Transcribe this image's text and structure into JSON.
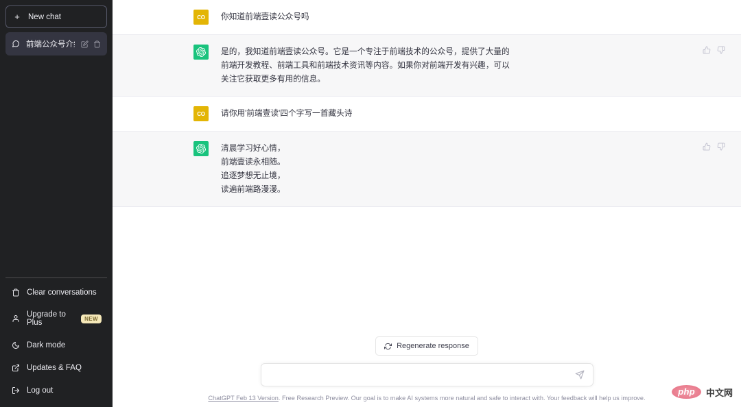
{
  "sidebar": {
    "new_chat_label": "New chat",
    "conversations": [
      {
        "title": "前端公众号介绍",
        "icon": "chat-bubble-icon",
        "edit_icon": "pencil-icon",
        "delete_icon": "trash-icon"
      }
    ],
    "bottom_items": [
      {
        "label": "Clear conversations",
        "icon": "trash-icon",
        "badge": ""
      },
      {
        "label": "Upgrade to Plus",
        "icon": "user-icon",
        "badge": "NEW"
      },
      {
        "label": "Dark mode",
        "icon": "moon-icon",
        "badge": ""
      },
      {
        "label": "Updates & FAQ",
        "icon": "external-link-icon",
        "badge": ""
      },
      {
        "label": "Log out",
        "icon": "logout-icon",
        "badge": ""
      }
    ]
  },
  "conversation": {
    "messages": [
      {
        "role": "user",
        "avatar_initials": "CO",
        "avatar_color": "#e3b505",
        "text": "你知道前端壹读公众号吗",
        "lines": []
      },
      {
        "role": "assistant",
        "avatar_initials": "",
        "avatar_color": "#19c37d",
        "text": "是的，我知道前端壹读公众号。它是一个专注于前端技术的公众号，提供了大量的前端开发教程、前端工具和前端技术资讯等内容。如果你对前端开发有兴趣，可以关注它获取更多有用的信息。",
        "lines": [],
        "feedback": {
          "up_icon": "thumbs-up-icon",
          "down_icon": "thumbs-down-icon"
        }
      },
      {
        "role": "user",
        "avatar_initials": "CO",
        "avatar_color": "#e3b505",
        "text": "请你用'前端壹读'四个字写一首藏头诗",
        "lines": []
      },
      {
        "role": "assistant",
        "avatar_initials": "",
        "avatar_color": "#19c37d",
        "text": "",
        "lines": [
          "清晨学习好心情，",
          "前端壹读永相随。",
          "追逐梦想无止境，",
          "读遍前端路漫漫。"
        ],
        "feedback": {
          "up_icon": "thumbs-up-icon",
          "down_icon": "thumbs-down-icon"
        }
      }
    ]
  },
  "composer": {
    "regenerate_label": "Regenerate response",
    "regenerate_icon": "refresh-icon",
    "input_value": "",
    "input_placeholder": "",
    "send_icon": "send-icon"
  },
  "footer": {
    "link_text": "ChatGPT Feb 13 Version",
    "rest_text": ". Free Research Preview. Our goal is to make AI systems more natural and safe to interact with. Your feedback will help us improve."
  },
  "watermark": {
    "logo_text": "php",
    "site_text": "中文网"
  },
  "colors": {
    "sidebar_bg": "#202123",
    "chat_item_bg": "#343541",
    "accent_green": "#19c37d",
    "user_avatar": "#e3b505",
    "bot_row_bg": "#f7f7f8",
    "badge_new_bg": "#f5e8b8"
  }
}
